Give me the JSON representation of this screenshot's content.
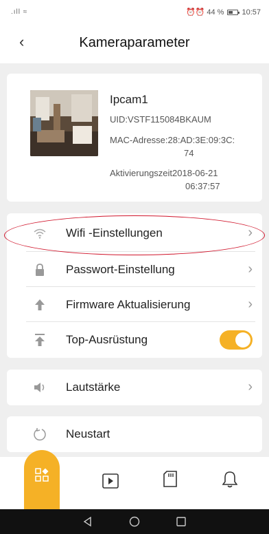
{
  "statusbar": {
    "signal": ".ıll",
    "wifi_glyph": "≈",
    "alarm_glyphs": "⏰⏰",
    "battery_text": "44 %",
    "time": "10:57"
  },
  "header": {
    "title": "Kameraparameter"
  },
  "device": {
    "name": "Ipcam1",
    "uid": "UID:VSTF115084BKAUM",
    "mac_line1": "MAC-Adresse:28:AD:3E:09:3C:",
    "mac_line2": "74",
    "activation_line1": "Aktivierungszeit2018-06-21",
    "activation_line2": "06:37:57"
  },
  "settings": {
    "wifi_label": "Wifi -Einstellungen",
    "password_label": "Passwort-Einstellung",
    "firmware_label": "Firmware Aktualisierung",
    "top_label": "Top-Ausrüstung",
    "top_enabled": true
  },
  "volume": {
    "label": "Lautstärke"
  },
  "restart": {
    "label": "Neustart"
  },
  "colors": {
    "accent": "#f5b126",
    "highlight": "#d0142a"
  },
  "icons": [
    "back-icon",
    "wifi-icon",
    "lock-icon",
    "upload-arrow-icon",
    "top-arrow-icon",
    "speaker-icon",
    "restart-icon",
    "devices-icon",
    "play-icon",
    "sdcard-icon",
    "bell-icon"
  ]
}
